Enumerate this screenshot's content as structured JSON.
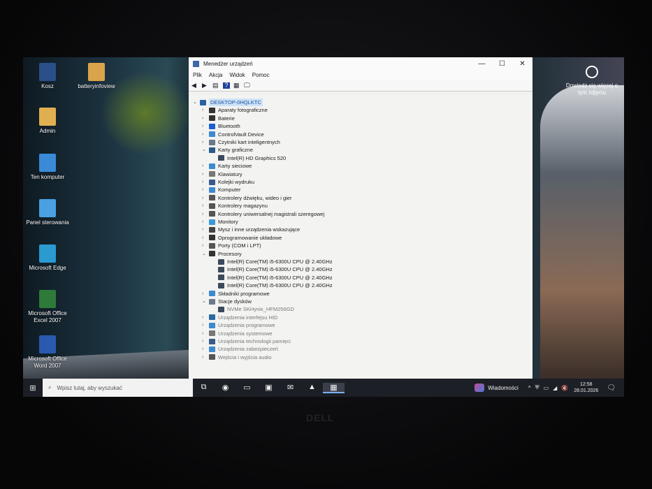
{
  "desktop_icons": [
    {
      "label": "Kosz",
      "color": "#2b4f8a"
    },
    {
      "label": "batteryinfoview",
      "color": "#d9a44a"
    },
    {
      "label": "Admin",
      "color": "#e0b050"
    },
    {
      "label": "Ten komputer",
      "color": "#3a8ad8"
    },
    {
      "label": "Panel sterowania",
      "color": "#4aa0e0"
    },
    {
      "label": "Microsoft Edge",
      "color": "#2a9ad0"
    },
    {
      "label": "Microsoft Office Excel 2007",
      "color": "#2e7a3a"
    },
    {
      "label": "Microsoft Office Word 2007",
      "color": "#2a5ab0"
    }
  ],
  "learn_more": "Dowiedz się więcej o tym zdjęciu",
  "window": {
    "title": "Menedżer urządzeń",
    "controls": [
      "—",
      "☐",
      "✕"
    ],
    "menu": [
      "Plik",
      "Akcja",
      "Widok",
      "Pomoc"
    ],
    "toolbar": [
      "◀",
      "▶",
      "▤",
      "?",
      "▦",
      "🖵"
    ],
    "tree": [
      {
        "label": "DESKTOP-0HQLKTC",
        "level": 0,
        "exp": "open",
        "sel": true
      },
      {
        "label": "Aparaty fotograficzne",
        "level": 1,
        "exp": "closed"
      },
      {
        "label": "Baterie",
        "level": 1,
        "exp": "closed"
      },
      {
        "label": "Bluetooth",
        "level": 1,
        "exp": "closed"
      },
      {
        "label": "ControlVault Device",
        "level": 1,
        "exp": "closed"
      },
      {
        "label": "Czytniki kart inteligentnych",
        "level": 1,
        "exp": "closed"
      },
      {
        "label": "Karty graficzne",
        "level": 1,
        "exp": "open"
      },
      {
        "label": "Intel(R) HD Graphics 520",
        "level": 2
      },
      {
        "label": "Karty sieciowe",
        "level": 1,
        "exp": "closed"
      },
      {
        "label": "Klawiatury",
        "level": 1,
        "exp": "closed"
      },
      {
        "label": "Kolejki wydruku",
        "level": 1,
        "exp": "closed"
      },
      {
        "label": "Komputer",
        "level": 1,
        "exp": "closed"
      },
      {
        "label": "Kontrolery dźwięku, wideo i gier",
        "level": 1,
        "exp": "closed"
      },
      {
        "label": "Kontrolery magazynu",
        "level": 1,
        "exp": "closed"
      },
      {
        "label": "Kontrolery uniwersalnej magistrali szeregowej",
        "level": 1,
        "exp": "closed"
      },
      {
        "label": "Monitory",
        "level": 1,
        "exp": "closed"
      },
      {
        "label": "Mysz i inne urządzenia wskazujące",
        "level": 1,
        "exp": "closed"
      },
      {
        "label": "Oprogramowanie układowe",
        "level": 1,
        "exp": "closed"
      },
      {
        "label": "Porty (COM i LPT)",
        "level": 1,
        "exp": "closed"
      },
      {
        "label": "Procesory",
        "level": 1,
        "exp": "open"
      },
      {
        "label": "Intel(R) Core(TM) i5-6300U CPU @ 2.40GHz",
        "level": 2
      },
      {
        "label": "Intel(R) Core(TM) i5-6300U CPU @ 2.40GHz",
        "level": 2
      },
      {
        "label": "Intel(R) Core(TM) i5-6300U CPU @ 2.40GHz",
        "level": 2
      },
      {
        "label": "Intel(R) Core(TM) i5-6300U CPU @ 2.40GHz",
        "level": 2
      },
      {
        "label": "Składniki programowe",
        "level": 1,
        "exp": "closed"
      },
      {
        "label": "Stacje dysków",
        "level": 1,
        "exp": "open"
      },
      {
        "label": "NVMe SKHynix_HFM256GD",
        "level": 2
      },
      {
        "label": "Urządzenia interfejsu HID",
        "level": 1,
        "exp": "closed"
      },
      {
        "label": "Urządzenia programowe",
        "level": 1,
        "exp": "closed"
      },
      {
        "label": "Urządzenia systemowe",
        "level": 1,
        "exp": "closed"
      },
      {
        "label": "Urządzenia technologii pamięci",
        "level": 1,
        "exp": "closed"
      },
      {
        "label": "Urządzenia zabezpieczeń",
        "level": 1,
        "exp": "closed"
      },
      {
        "label": "Wejścia i wyjścia audio",
        "level": 1,
        "exp": "closed"
      }
    ]
  },
  "taskbar": {
    "start": "⊞",
    "search_placeholder": "Wpisz tutaj, aby wyszukać",
    "search_icon": "⌕",
    "apps": [
      "task-view",
      "edge",
      "explorer",
      "store",
      "mail",
      "app",
      "device-manager"
    ],
    "app_glyphs": [
      "⧉",
      "◉",
      "▭",
      "▣",
      "✉",
      "▲",
      "▦"
    ],
    "news": "Wiadomości",
    "tray": [
      "^",
      "⛨",
      "▭",
      "◢",
      "🔇"
    ],
    "time": "12:58",
    "date": "28.01.2026",
    "notifications": "🗨"
  },
  "brand": "DELL"
}
